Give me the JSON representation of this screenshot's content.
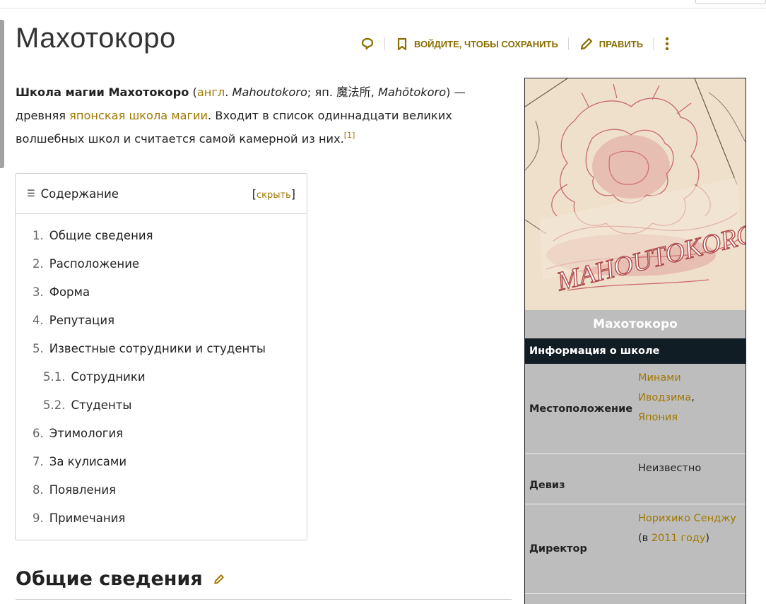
{
  "page": {
    "title": "Махотокоро"
  },
  "actions": {
    "save_label": "ВОЙДИТЕ, ЧТОБЫ СОХРАНИТЬ",
    "edit_label": "ПРАВИТЬ"
  },
  "lead": {
    "bold_name": "Школа магии Махотокоро",
    "paren_open": " (",
    "link_engl": "англ",
    "text_1": ". ",
    "eng_name": "Mahoutokoro",
    "text_2": "; яп. 魔法所, ",
    "jp_romaji": "Mahōtokoro",
    "text_3": ") — древняя ",
    "link_school": "японская школа магии",
    "text_4": ". Входит в список одиннадцати великих волшебных школ и считается самой камерной из них.",
    "ref": "[1]"
  },
  "toc": {
    "title": "Содержание",
    "toggle_open": "[",
    "toggle_label": "скрыть",
    "toggle_close": "]",
    "items": [
      {
        "num": "1.",
        "label": "Общие сведения"
      },
      {
        "num": "2.",
        "label": "Расположение"
      },
      {
        "num": "3.",
        "label": "Форма"
      },
      {
        "num": "4.",
        "label": "Репутация"
      },
      {
        "num": "5.",
        "label": "Известные сотрудники и студенты"
      },
      {
        "num": "5.1.",
        "label": "Сотрудники"
      },
      {
        "num": "5.2.",
        "label": "Студенты"
      },
      {
        "num": "6.",
        "label": "Этимология"
      },
      {
        "num": "7.",
        "label": "За кулисами"
      },
      {
        "num": "8.",
        "label": "Появления"
      },
      {
        "num": "9.",
        "label": "Примечания"
      }
    ]
  },
  "section": {
    "heading": "Общие сведения"
  },
  "infobox": {
    "image_text": "MAHOUTOKORO",
    "caption": "Махотокоро",
    "section_label": "Информация о школе",
    "location_label": "Местоположение",
    "location_link1": "Минами Иводзима",
    "location_comma": ",",
    "location_link2": "Япония",
    "motto_label": "Девиз",
    "motto_value": "Неизвестно",
    "director_label": "Директор",
    "director_link": "Норихико Сенджу",
    "director_mid": " (в ",
    "director_year": "2011 году",
    "director_end": ")"
  },
  "colors": {
    "accent": "#a07800",
    "infobox_bg": "#bdbdbd",
    "infobox_header": "#111d24"
  }
}
